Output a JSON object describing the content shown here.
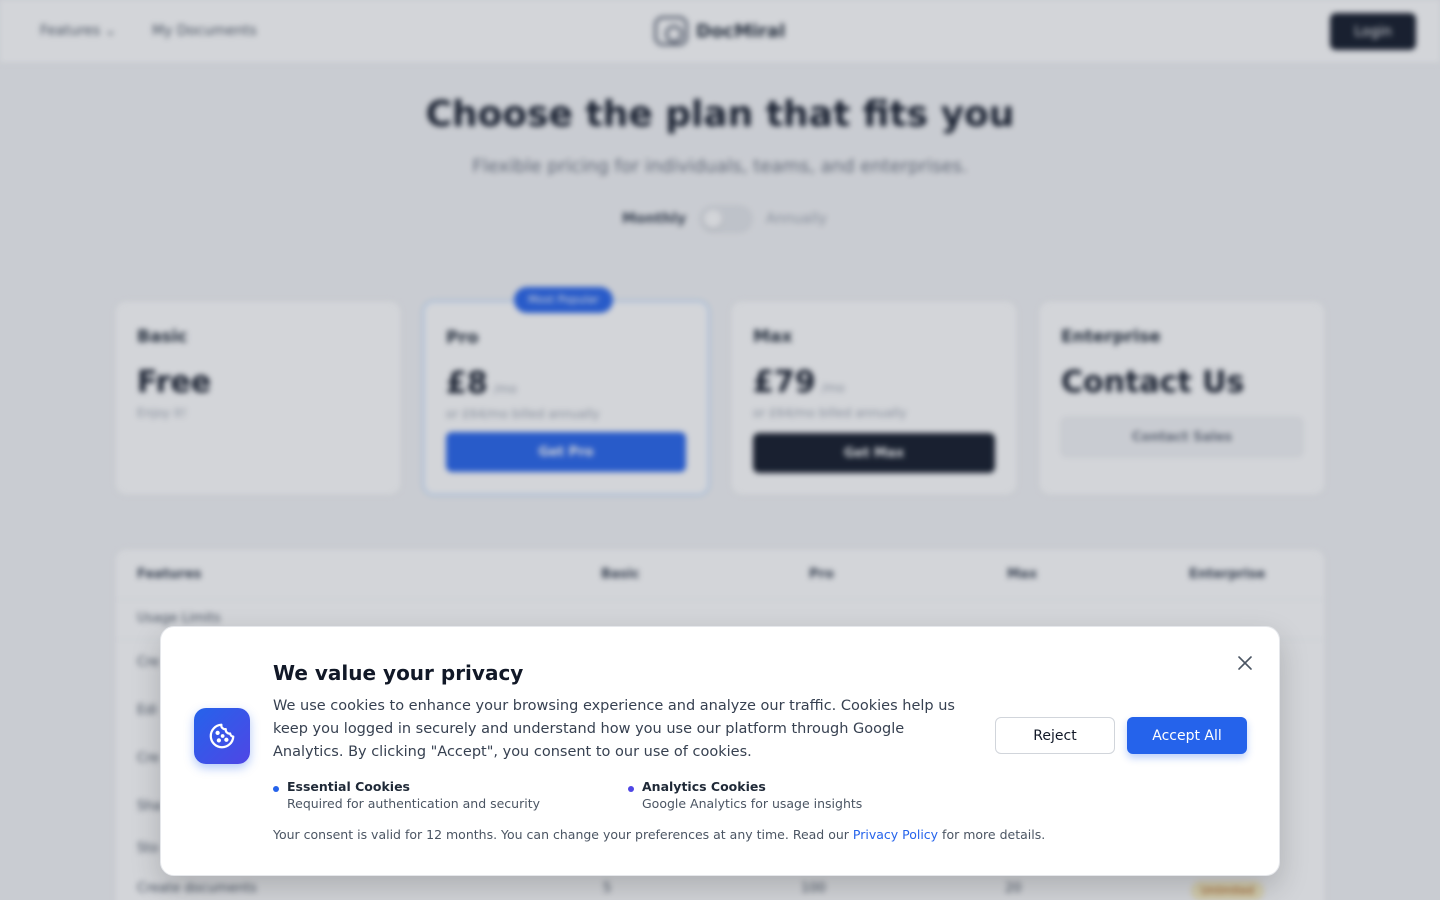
{
  "nav": {
    "features": "Features",
    "documents": "My Documents",
    "brand": "DocMiral",
    "login": "Login"
  },
  "hero": {
    "title": "Choose the plan that fits you",
    "subtitle": "Flexible pricing for individuals, teams, and enterprises.",
    "monthly": "Monthly",
    "annually": "Annually"
  },
  "plans": [
    {
      "name": "Basic",
      "price": "Free",
      "per": "",
      "note": "Enjoy it!",
      "button": ""
    },
    {
      "name": "Pro",
      "price": "£8",
      "per": "/mo",
      "note": "or £64/mo billed annually",
      "button": "Get Pro",
      "badge": "Most Popular"
    },
    {
      "name": "Max",
      "price": "£79",
      "per": "/mo",
      "note": "or £64/mo billed annually",
      "button": "Get Max"
    },
    {
      "name": "Enterprise",
      "price": "Contact Us",
      "per": "",
      "note": "",
      "button": "Contact Sales"
    }
  ],
  "table": {
    "headers": [
      "Features",
      "Basic",
      "Pro",
      "Max",
      "Enterprise"
    ],
    "section": "Usage Limits",
    "rows": [
      "Cre",
      "Edi",
      "Cre",
      "Sha",
      "Sto",
      "Create documents"
    ],
    "last_row": [
      "5",
      "100",
      "20",
      "Unlimited"
    ]
  },
  "cookie": {
    "title": "We value your privacy",
    "text": "We use cookies to enhance your browsing experience and analyze our traffic. Cookies help us keep you logged in securely and understand how you use our platform through Google Analytics. By clicking \"Accept\", you consent to our use of cookies.",
    "essential_title": "Essential Cookies",
    "essential_desc": "Required for authentication and security",
    "analytics_title": "Analytics Cookies",
    "analytics_desc": "Google Analytics for usage insights",
    "footer_pre": "Your consent is valid for 12 months. You can change your preferences at any time. Read our ",
    "footer_link": "Privacy Policy",
    "footer_post": " for more details.",
    "reject": "Reject",
    "accept": "Accept All"
  },
  "colors": {
    "accent": "#2563eb",
    "accent_indigo": "#4f46e5",
    "dark": "#111827"
  }
}
